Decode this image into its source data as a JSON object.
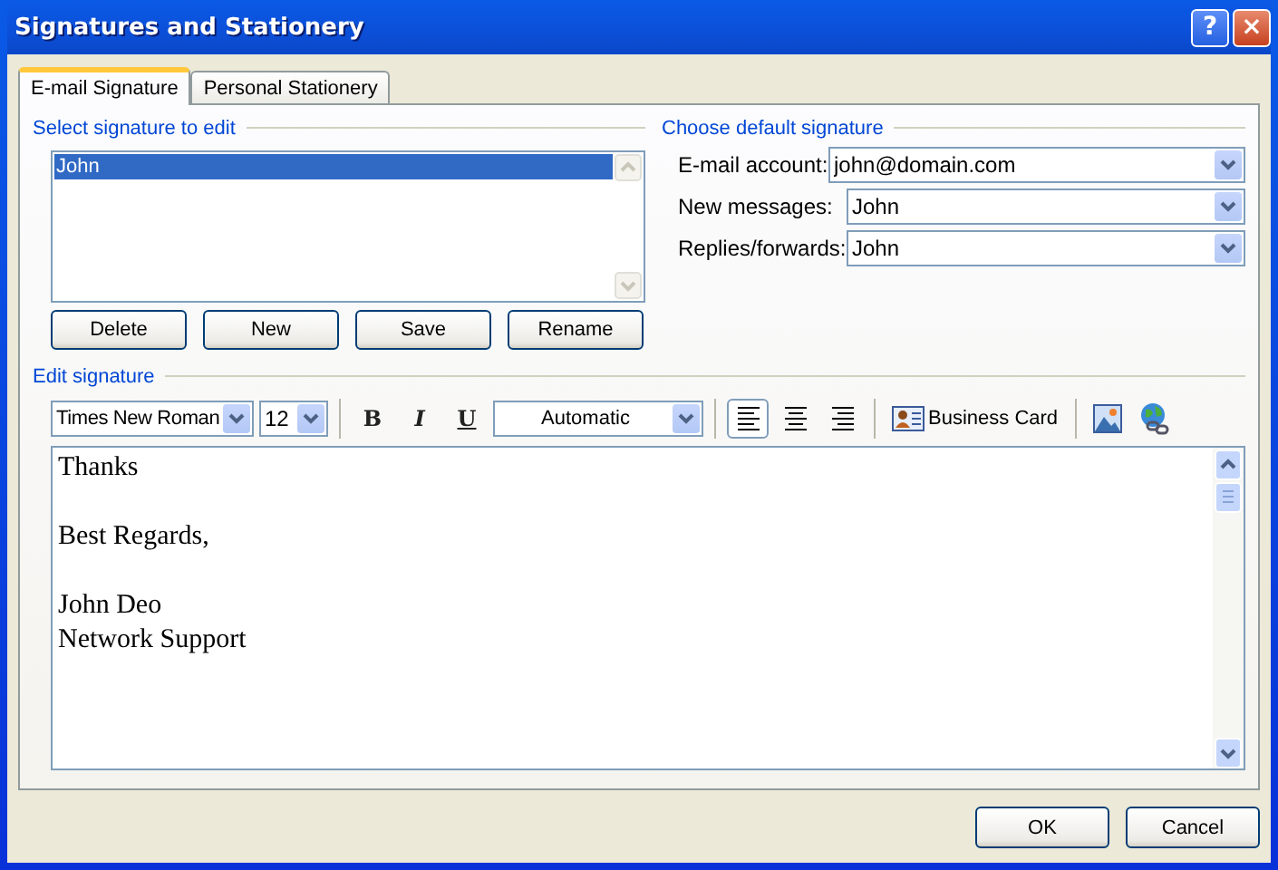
{
  "window": {
    "title": "Signatures and Stationery",
    "help": "?",
    "close": "×"
  },
  "tabs": [
    {
      "label": "E-mail Signature",
      "selected": true
    },
    {
      "label": "Personal Stationery",
      "selected": false
    }
  ],
  "select_signature": {
    "heading": "Select signature to edit",
    "items": [
      {
        "label": "John",
        "selected": true
      }
    ],
    "buttons": [
      "Delete",
      "New",
      "Save",
      "Rename"
    ]
  },
  "default_signature": {
    "heading": "Choose default signature",
    "fields": [
      {
        "label": "E-mail account:",
        "value": "john@domain.com"
      },
      {
        "label": "New messages:",
        "value": "John"
      },
      {
        "label": "Replies/forwards:",
        "value": "John"
      }
    ]
  },
  "edit_signature": {
    "heading": "Edit signature",
    "toolbar": {
      "font": "Times New Roman",
      "size": "12",
      "bold": "B",
      "italic": "I",
      "underline": "U",
      "text_color": "Automatic",
      "align": [
        {
          "kind": "left",
          "selected": true
        },
        {
          "kind": "center",
          "selected": false
        },
        {
          "kind": "right",
          "selected": false
        }
      ],
      "business_card": "Business Card"
    },
    "paragraphs": [
      [
        "Thanks"
      ],
      [
        "Best Regards,"
      ],
      [
        "John Deo",
        "Network Support"
      ]
    ]
  },
  "buttons": [
    "OK",
    "Cancel"
  ]
}
